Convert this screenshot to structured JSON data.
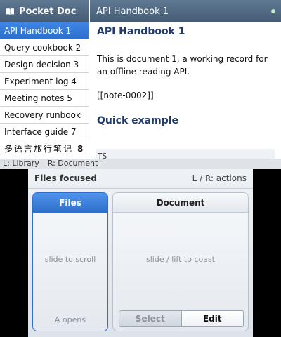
{
  "sidebar": {
    "title": "Pocket Doc",
    "items": [
      {
        "label": "API Handbook 1"
      },
      {
        "label": "Query cookbook 2"
      },
      {
        "label": "Design decision 3"
      },
      {
        "label": "Experiment log 4"
      },
      {
        "label": "Meeting notes 5"
      },
      {
        "label": "Recovery runbook"
      },
      {
        "label": "Interface guide 7"
      },
      {
        "label": "多语言旅行笔记",
        "num": "8"
      }
    ],
    "selected_index": 0
  },
  "document": {
    "header_title": "API Handbook 1",
    "title": "API Handbook 1",
    "paragraph": "This is document 1, a working record for an offline reading API.",
    "link": "[[note-0002]]",
    "subheading": "Quick example",
    "code_first_line": "TS"
  },
  "status": {
    "left_hint": "L: Library",
    "right_hint": "R: Document"
  },
  "bottom": {
    "focus_label": "Files focused",
    "shoulder_hint": "L / R: actions",
    "files_panel": {
      "title": "Files",
      "hint": "slide to scroll",
      "action_hint": "A opens"
    },
    "document_panel": {
      "title": "Document",
      "hint": "slide / lift to coast",
      "select_label": "Select",
      "edit_label": "Edit"
    }
  },
  "colors": {
    "header_bg": "#4f6680",
    "selection": "#3479d8",
    "heading": "#213b6e",
    "focus_blue": "#2f6fc9"
  }
}
